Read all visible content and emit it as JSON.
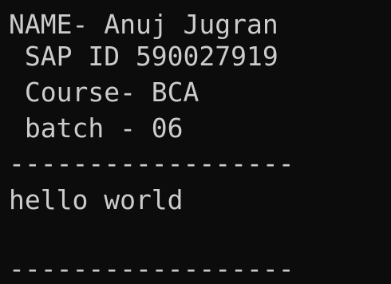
{
  "terminal": {
    "colors": {
      "background": "#0c0c0c",
      "foreground": "#cccccc"
    },
    "lines": [
      "NAME- Anuj Jugran",
      " SAP ID 590027919",
      " Course- BCA",
      " batch - 06",
      "------------------",
      "hello world",
      "------------------"
    ]
  }
}
